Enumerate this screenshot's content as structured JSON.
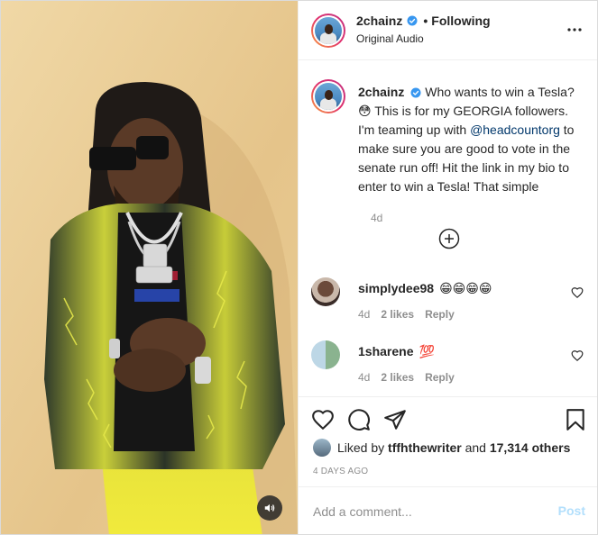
{
  "post": {
    "username": "2chainz",
    "follow_state": "Following",
    "dot": "•",
    "audio": "Original Audio",
    "more_icon": "more-horizontal-icon"
  },
  "caption": {
    "username": "2chainz",
    "text_1": "Who wants to win a Tesla? ",
    "emoji": "😳",
    "text_2": " This is for my GEORGIA followers. I'm teaming up with ",
    "mention": "@headcountorg",
    "text_3": " to make sure you are good to vote in the senate run off! Hit the link in my bio to enter to win a Tesla! That simple",
    "time": "4d"
  },
  "comments": [
    {
      "username": "simplydee98",
      "emoji": "😁😁😁😁",
      "time": "4d",
      "likes": "2 likes",
      "reply": "Reply"
    },
    {
      "username": "1sharene",
      "emoji": "💯",
      "time": "4d",
      "likes": "2 likes",
      "reply": "Reply"
    }
  ],
  "actions": {
    "like_icon": "heart-icon",
    "comment_icon": "comment-icon",
    "share_icon": "send-icon",
    "save_icon": "bookmark-icon"
  },
  "likes": {
    "prefix": "Liked by ",
    "user": "tffhthewriter",
    "middle": " and ",
    "count": "17,314 others"
  },
  "date": "4 DAYS AGO",
  "add_comment": {
    "placeholder": "Add a comment...",
    "post_label": "Post"
  },
  "colors": {
    "verified": "#3897f0",
    "link": "#00376b",
    "muted": "#8e8e8e",
    "post_disabled": "#b2dffc",
    "jacket_yellow": "#d8d83a"
  }
}
